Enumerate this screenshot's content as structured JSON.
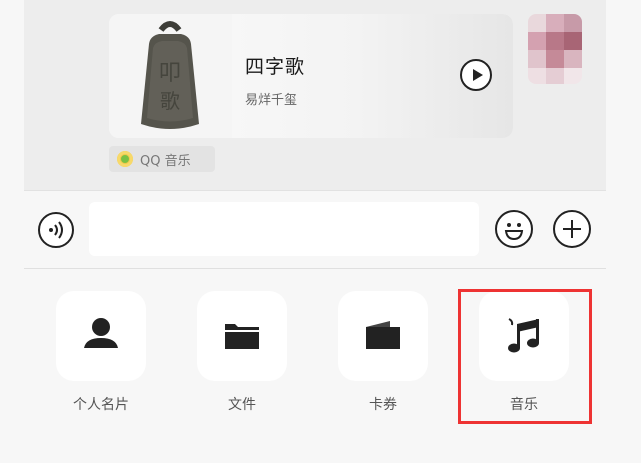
{
  "song": {
    "title": "四字歌",
    "artist": "易烊千玺"
  },
  "source": {
    "label": "QQ 音乐"
  },
  "composer": {
    "placeholder": ""
  },
  "actions": [
    {
      "label": "个人名片",
      "icon": "person-icon"
    },
    {
      "label": "文件",
      "icon": "folder-icon"
    },
    {
      "label": "卡券",
      "icon": "wallet-icon"
    },
    {
      "label": "音乐",
      "icon": "music-note-icon"
    }
  ],
  "colors": {
    "highlight": "#ee3333",
    "qq_music_green": "#7ac144",
    "qq_music_yellow": "#f0c84a"
  }
}
